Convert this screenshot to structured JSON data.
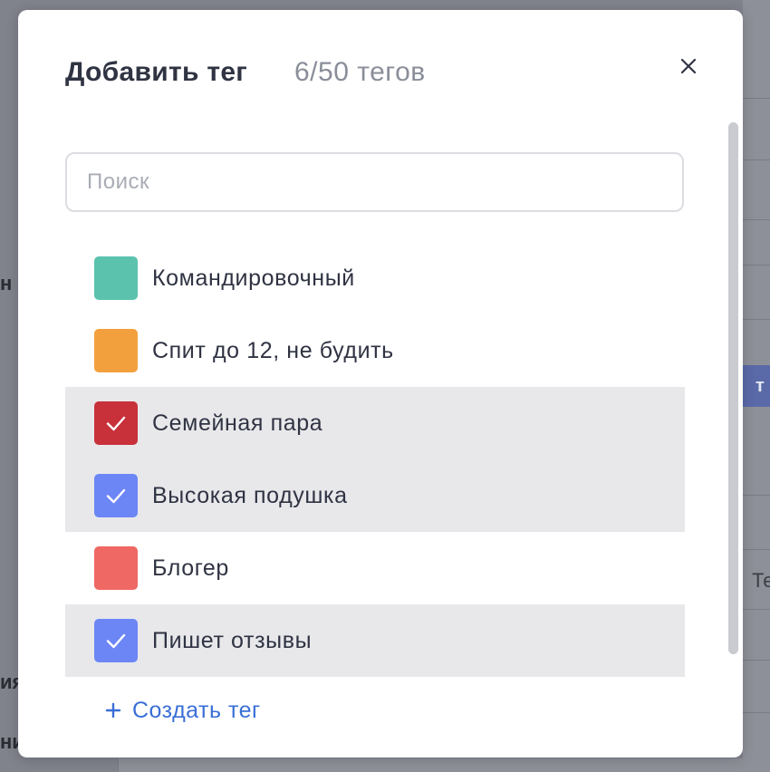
{
  "background": {
    "right_fragment_blue": "т о",
    "right_fragment_text": "Те",
    "left_fragments": [
      "н",
      "ия",
      "ни"
    ]
  },
  "modal": {
    "title": "Добавить тег",
    "count": "6/50 тегов",
    "close_icon": "close-icon",
    "search": {
      "placeholder": "Поиск",
      "value": ""
    },
    "tags": [
      {
        "label": "Командировочный",
        "color": "#5bc2ae",
        "selected": false
      },
      {
        "label": "Спит до 12, не будить",
        "color": "#f2a03d",
        "selected": false
      },
      {
        "label": "Семейная пара",
        "color": "#c8303a",
        "selected": true
      },
      {
        "label": "Высокая подушка",
        "color": "#6c86f5",
        "selected": true
      },
      {
        "label": "Блогер",
        "color": "#ef6864",
        "selected": false
      },
      {
        "label": "Пишет отзывы",
        "color": "#6c86f5",
        "selected": true
      }
    ],
    "create_button": {
      "label": "Создать тег",
      "icon": "plus-icon",
      "color": "#3a6fd6"
    }
  }
}
